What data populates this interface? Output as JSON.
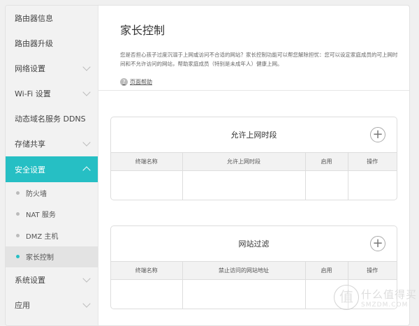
{
  "sidebar": {
    "items": [
      {
        "label": "路由器信息"
      },
      {
        "label": "路由器升级"
      },
      {
        "label": "网络设置"
      },
      {
        "label": "Wi-Fi 设置"
      },
      {
        "label": "动态域名服务 DDNS"
      },
      {
        "label": "存储共享"
      },
      {
        "label": "安全设置"
      },
      {
        "label": "系统设置"
      },
      {
        "label": "应用"
      }
    ],
    "sub_items": [
      {
        "label": "防火墙"
      },
      {
        "label": "NAT 服务"
      },
      {
        "label": "DMZ 主机"
      },
      {
        "label": "家长控制"
      }
    ]
  },
  "main": {
    "title": "家长控制",
    "description": "您是否担心孩子过度沉溺于上网或访问不合适的网站？家长控制功能可以帮您解除担忧：您可以设定家庭成员的可上网时间和不允许访问的网站，帮助家庭成员（特别是未成年人）健康上网。",
    "help_link": "页面帮助",
    "help_icon": "?",
    "time_card": {
      "title": "允许上网时段",
      "add_icon": "+",
      "columns": [
        "终端名称",
        "允许上网时段",
        "启用",
        "操作"
      ]
    },
    "site_card": {
      "title": "网站过滤",
      "add_icon": "+",
      "columns": [
        "终端名称",
        "禁止访问的网站地址",
        "启用",
        "操作"
      ]
    }
  },
  "watermark": {
    "seal": "值",
    "cn": "什么值得买",
    "en": "SMZDM.COM"
  },
  "colors": {
    "accent": "#26bfc4"
  }
}
